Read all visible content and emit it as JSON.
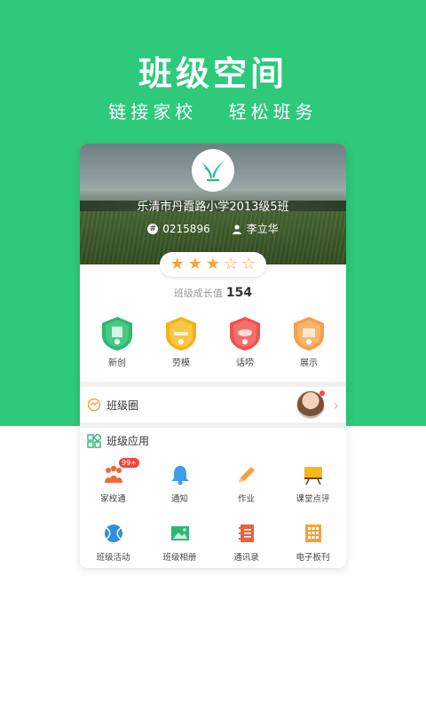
{
  "header": {
    "title": "班级空间",
    "subtitle_left": "链接家校",
    "subtitle_right": "轻松班务"
  },
  "card": {
    "school_name": "乐清市丹霞路小学2013级5班",
    "class_id": "0215896",
    "teacher": "李立华",
    "stars_filled": 3,
    "stars_total": 5,
    "growth_label": "班级成长值",
    "growth_value": "154",
    "badges": [
      {
        "label": "新创",
        "color": "#2eb872"
      },
      {
        "label": "劳模",
        "color": "#f3b21b"
      },
      {
        "label": "话唠",
        "color": "#ef5350"
      },
      {
        "label": "展示",
        "color": "#f6a04a"
      }
    ],
    "circle_label": "班级圈",
    "apps_title": "班级应用",
    "apps": [
      {
        "label": "家校通",
        "icon": "people-icon",
        "badge": "99+"
      },
      {
        "label": "通知",
        "icon": "bell-icon"
      },
      {
        "label": "作业",
        "icon": "pencil-icon"
      },
      {
        "label": "课堂点评",
        "icon": "board-icon"
      },
      {
        "label": "班级活动",
        "icon": "ball-icon"
      },
      {
        "label": "班级相册",
        "icon": "photo-icon"
      },
      {
        "label": "通讯录",
        "icon": "contacts-icon"
      },
      {
        "label": "电子板刊",
        "icon": "grid-icon"
      }
    ]
  },
  "colors": {
    "brand_green": "#2ec97a",
    "star": "#f4a53a"
  }
}
